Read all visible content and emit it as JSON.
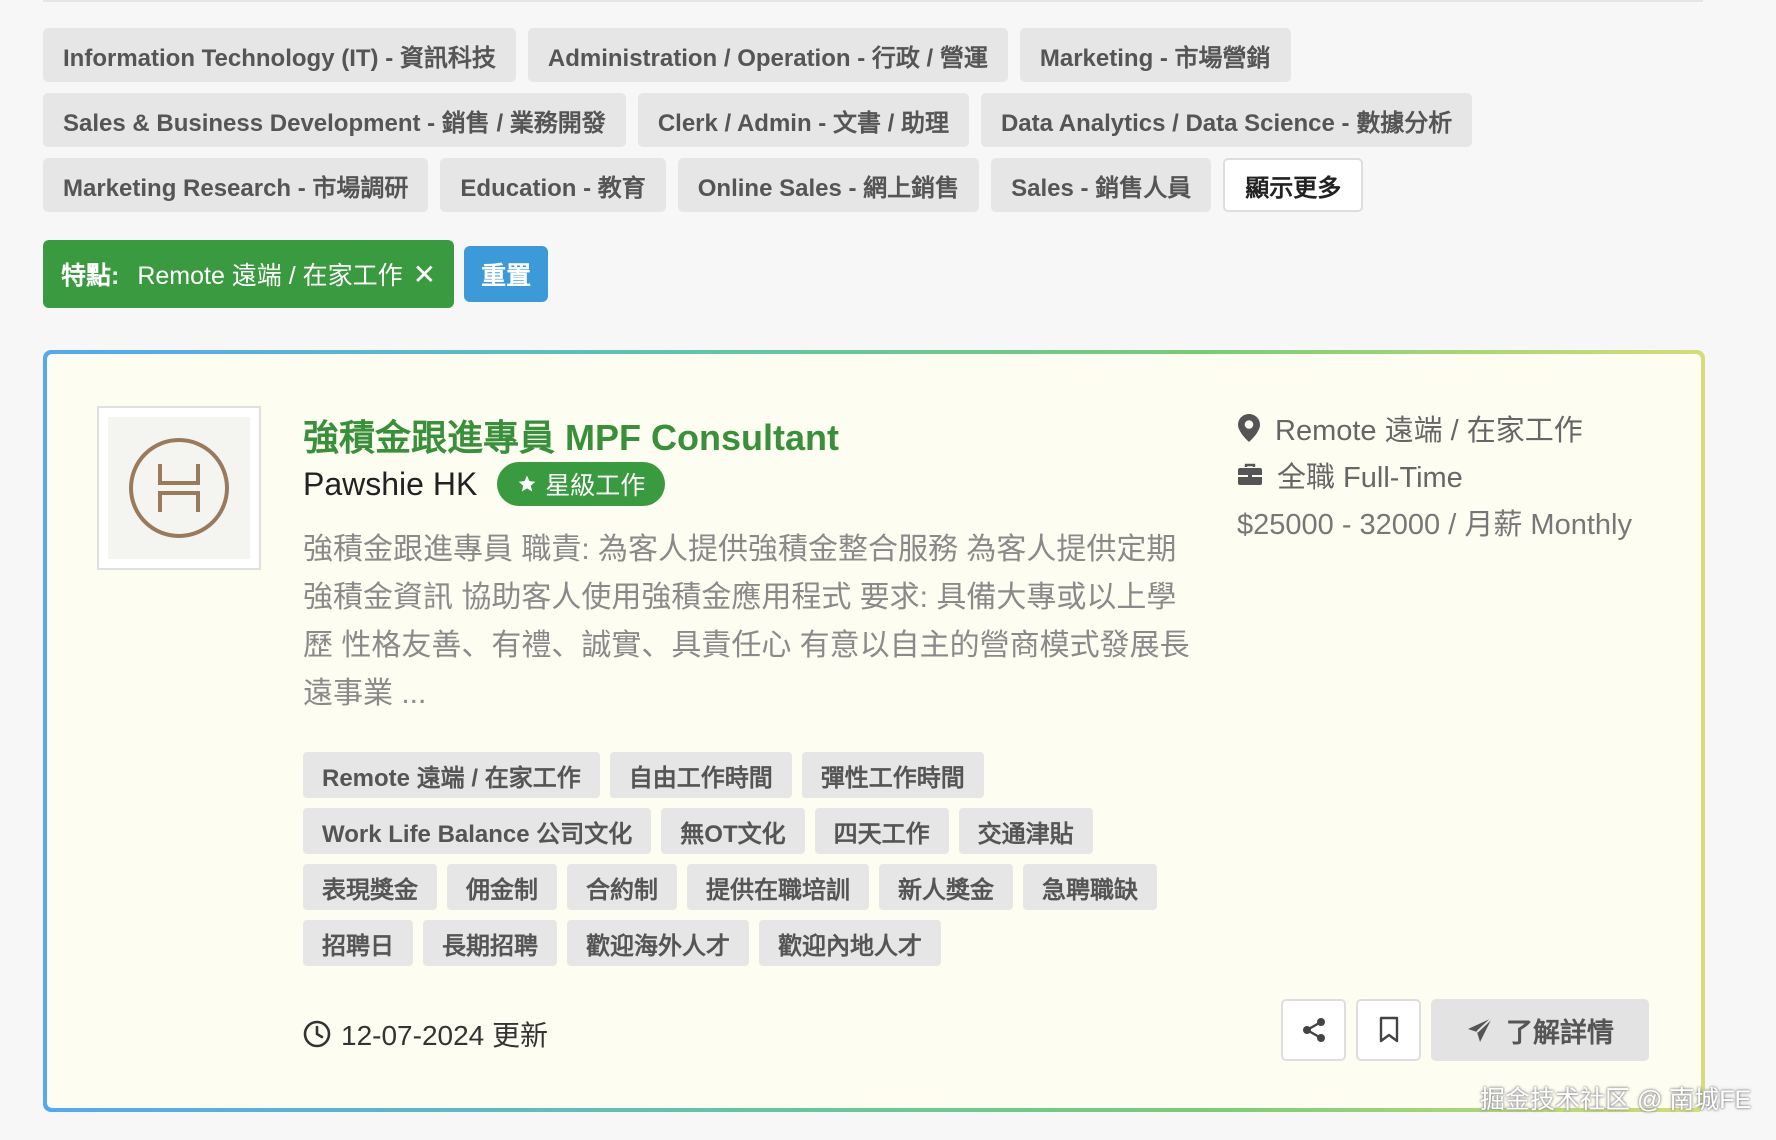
{
  "categories": [
    [
      "Information Technology (IT) - 資訊科技",
      "Administration / Operation - 行政 / 營運",
      "Marketing - 市場營銷"
    ],
    [
      "Sales & Business Development - 銷售 / 業務開發",
      "Clerk / Admin - 文書 / 助理",
      "Data Analytics / Data Science - 數據分析"
    ],
    [
      "Marketing Research - 市場調研",
      "Education - 教育",
      "Online Sales - 網上銷售",
      "Sales - 銷售人員"
    ]
  ],
  "show_more_label": "顯示更多",
  "active_filter": {
    "key": "特點:",
    "value": "Remote 遠端 / 在家工作",
    "remove_glyph": "✕"
  },
  "reset_label": "重置",
  "job": {
    "title": "強積金跟進專員 MPF Consultant",
    "company": "Pawshie HK",
    "badge": "星級工作",
    "description": "強積金跟進專員 職責: 為客人提供強積金整合服務 為客人提供定期強積金資訊 協助客人使用強積金應用程式 要求: 具備大專或以上學歷 性格友善、有禮、誠實、具責任心 有意以自主的營商模式發展長遠事業 ...",
    "location": "Remote 遠端 / 在家工作",
    "job_type": "全職 Full-Time",
    "salary": "$25000 - 32000 / 月薪 Monthly",
    "tags": [
      [
        "Remote 遠端 / 在家工作",
        "自由工作時間",
        "彈性工作時間"
      ],
      [
        "Work Life Balance 公司文化",
        "無OT文化",
        "四天工作",
        "交通津貼"
      ],
      [
        "表現獎金",
        "佣金制",
        "合約制",
        "提供在職培訓",
        "新人獎金",
        "急聘職缺"
      ],
      [
        "招聘日",
        "長期招聘",
        "歡迎海外人才",
        "歡迎內地人才"
      ]
    ],
    "updated": "12-07-2024 更新",
    "detail_label": "了解詳情"
  },
  "icons": {
    "location": "map-pin-icon",
    "job_type": "briefcase-icon",
    "updated": "clock-icon",
    "share": "share-icon",
    "bookmark": "bookmark-icon",
    "detail": "paper-plane-icon",
    "star": "star-icon",
    "logo": "company-logo"
  },
  "colors": {
    "green": "#3a9a3f",
    "blue": "#3d9ad9",
    "title_green": "#3a8f3b",
    "card_bg": "#fefdf2"
  },
  "watermark": "掘金技术社区 @ 南城FE"
}
